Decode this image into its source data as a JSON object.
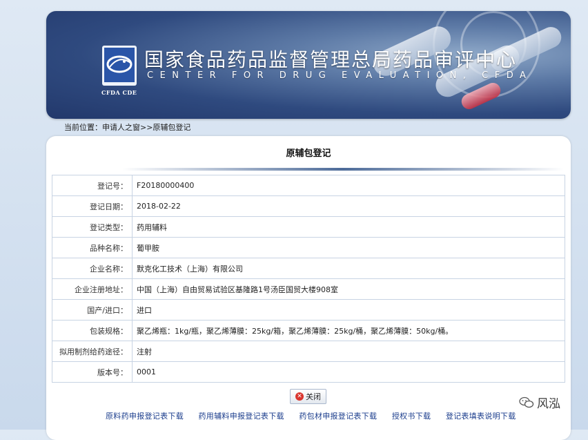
{
  "header": {
    "logo_caption": "CFDA CDE",
    "cn_title": "国家食品药品监督管理总局药品审评中心",
    "en_title": "CENTER FOR DRUG EVALUATION, CFDA"
  },
  "breadcrumb": "当前位置：申请人之窗>>原辅包登记",
  "panel": {
    "title": "原辅包登记",
    "rows": [
      {
        "label": "登记号：",
        "value": "F20180000400"
      },
      {
        "label": "登记日期：",
        "value": "2018-02-22"
      },
      {
        "label": "登记类型：",
        "value": "药用辅料"
      },
      {
        "label": "品种名称：",
        "value": "葡甲胺"
      },
      {
        "label": "企业名称：",
        "value": "默克化工技术（上海）有限公司"
      },
      {
        "label": "企业注册地址：",
        "value": "中国（上海）自由贸易试验区基隆路1号汤臣国贸大楼908室"
      },
      {
        "label": "国产/进口：",
        "value": "进口"
      },
      {
        "label": "包装规格：",
        "value": "聚乙烯瓶：1kg/瓶，聚乙烯薄膜：25kg/箱，聚乙烯薄膜：25kg/桶，聚乙烯薄膜：50kg/桶。"
      },
      {
        "label": "拟用制剂给药途径：",
        "value": "注射"
      },
      {
        "label": "版本号：",
        "value": "0001"
      }
    ],
    "close_label": "关闭"
  },
  "downloads": [
    "原料药申报登记表下载",
    "药用辅料申报登记表下载",
    "药包材申报登记表下载",
    "授权书下载",
    "登记表填表说明下载"
  ],
  "watermark": "风泓",
  "colors": {
    "banner_dark": "#22386b",
    "link": "#1a3c8c",
    "close_icon": "#d9362f"
  }
}
